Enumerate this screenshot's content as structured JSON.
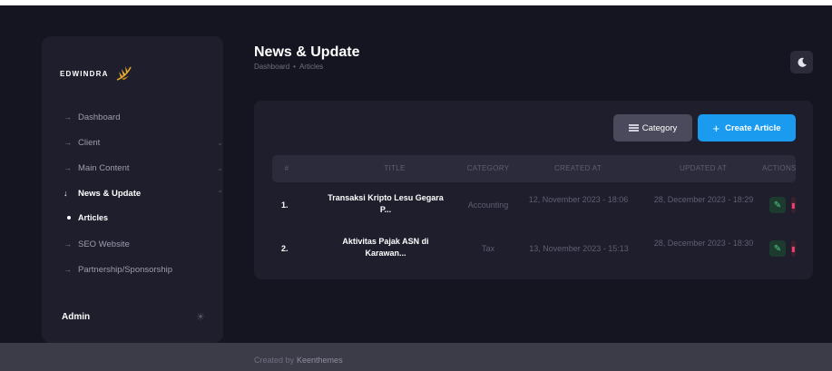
{
  "sidebar": {
    "logo": "EDWINDRA",
    "items": [
      {
        "label": "Dashboard"
      },
      {
        "label": "Client"
      },
      {
        "label": "Main Content"
      },
      {
        "label": "News & Update"
      },
      {
        "label": "SEO Website"
      },
      {
        "label": "Partnership/Sponsorship"
      }
    ],
    "sub_item": "Articles",
    "user": "Admin"
  },
  "header": {
    "title": "News & Update",
    "breadcrumb": [
      "Dashboard",
      "Articles"
    ]
  },
  "toolbar": {
    "category_label": "Category",
    "create_label": "Create Article"
  },
  "table": {
    "columns": [
      "#",
      "TITLE",
      "CATEGORY",
      "CREATED AT",
      "UPDATED AT",
      "ACTIONS"
    ],
    "rows": [
      {
        "num": "1.",
        "title": "Transaksi Kripto Lesu Gegara P...",
        "category": "Accounting",
        "created": "12, November 2023 - 18:06",
        "updated": "28, December 2023 - 18:29"
      },
      {
        "num": "2.",
        "title": "Aktivitas Pajak ASN di Karawan...",
        "category": "Tax",
        "created": "13, November 2023 - 15:13",
        "updated": "28, December 2023 - 18:30"
      }
    ]
  },
  "footer": {
    "prefix": "Created by",
    "brand": "Keenthemes"
  },
  "colors": {
    "background": "#151521",
    "panel": "#1e1e2d",
    "primary": "#1a9bf0",
    "edit": "#50cd89",
    "delete": "#f1416c"
  }
}
